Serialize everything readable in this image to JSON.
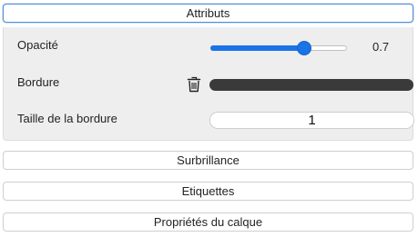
{
  "sections": {
    "attributs": "Attributs",
    "surbrillance": "Surbrillance",
    "etiquettes": "Etiquettes",
    "proprietes": "Propriétés du calque"
  },
  "attributs": {
    "opacity": {
      "label": "Opacité",
      "value": 0.7,
      "value_text": "0.7",
      "min": 0,
      "max": 1
    },
    "border": {
      "label": "Bordure",
      "color": "#3a3a3a",
      "delete_icon": "trash-icon"
    },
    "border_size": {
      "label": "Taille de la bordure",
      "value": "1"
    }
  },
  "colors": {
    "accent": "#1a73e8",
    "panel_bg": "#eeeeee",
    "active_border": "#4f8fd6"
  }
}
